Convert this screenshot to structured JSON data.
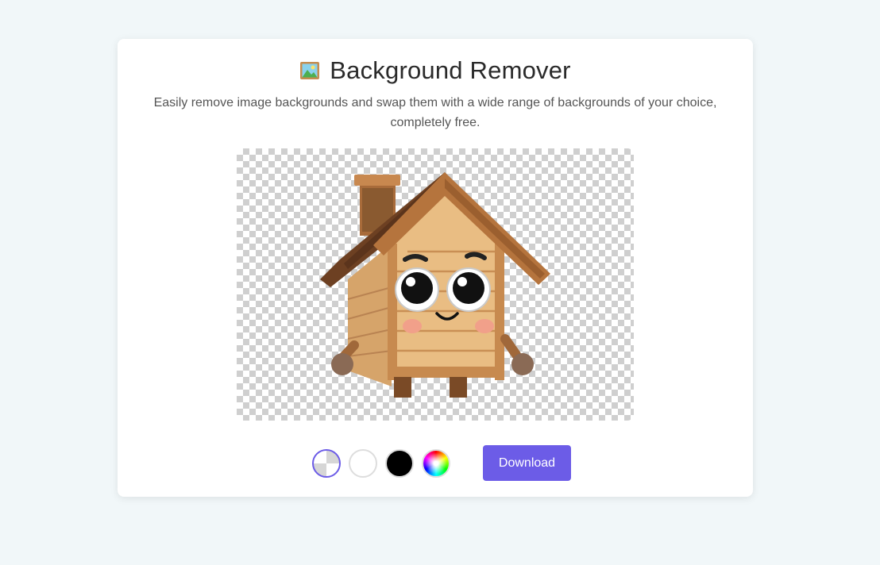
{
  "header": {
    "icon": "framed-picture-icon",
    "title": "Background Remover",
    "subtitle": "Easily remove image backgrounds and swap them with a wide range of backgrounds of your choice, completely free."
  },
  "preview": {
    "image": "wooden-house-character",
    "background": "transparent-checkerboard"
  },
  "background_options": [
    {
      "name": "transparent",
      "selected": true,
      "color": "checkerboard"
    },
    {
      "name": "white",
      "selected": false,
      "color": "#ffffff"
    },
    {
      "name": "black",
      "selected": false,
      "color": "#000000"
    },
    {
      "name": "custom-color",
      "selected": false,
      "color": "rainbow"
    }
  ],
  "actions": {
    "download_label": "Download"
  },
  "colors": {
    "accent": "#6c5ce7",
    "page_background": "#f1f7f9",
    "card_background": "#ffffff"
  }
}
